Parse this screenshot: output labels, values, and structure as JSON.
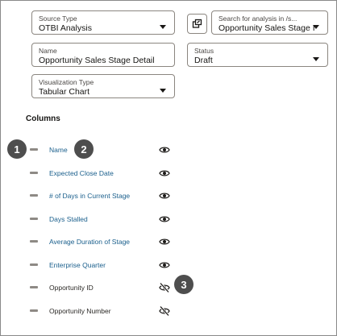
{
  "form": {
    "source_type": {
      "label": "Source Type",
      "value": "OTBI Analysis"
    },
    "search_analysis": {
      "label": "Search for analysis in /s...",
      "value": "Opportunity Sales Stage I"
    },
    "name": {
      "label": "Name",
      "value": "Opportunity Sales Stage Detail"
    },
    "status": {
      "label": "Status",
      "value": "Draft"
    },
    "visualization_type": {
      "label": "Visualization Type",
      "value": "Tabular Chart"
    }
  },
  "columns": {
    "title": "Columns",
    "items": [
      {
        "name": "Name",
        "visible": true
      },
      {
        "name": "Expected Close Date",
        "visible": true
      },
      {
        "name": "# of Days in Current Stage",
        "visible": true
      },
      {
        "name": "Days Stalled",
        "visible": true
      },
      {
        "name": "Average Duration of Stage",
        "visible": true
      },
      {
        "name": "Enterprise Quarter",
        "visible": true
      },
      {
        "name": "Opportunity ID",
        "visible": false
      },
      {
        "name": "Opportunity Number",
        "visible": false
      }
    ]
  },
  "callouts": [
    "1",
    "2",
    "3"
  ],
  "icons": {
    "browse": "copy-browse-icon",
    "visible": "eye-icon",
    "hidden": "eye-slash-icon",
    "drag": "drag-handle-icon",
    "dropdown": "caret-down-icon"
  },
  "colors": {
    "link": "#1a5f8c",
    "callout": "#4e4e4e",
    "border": "#8b8680"
  }
}
